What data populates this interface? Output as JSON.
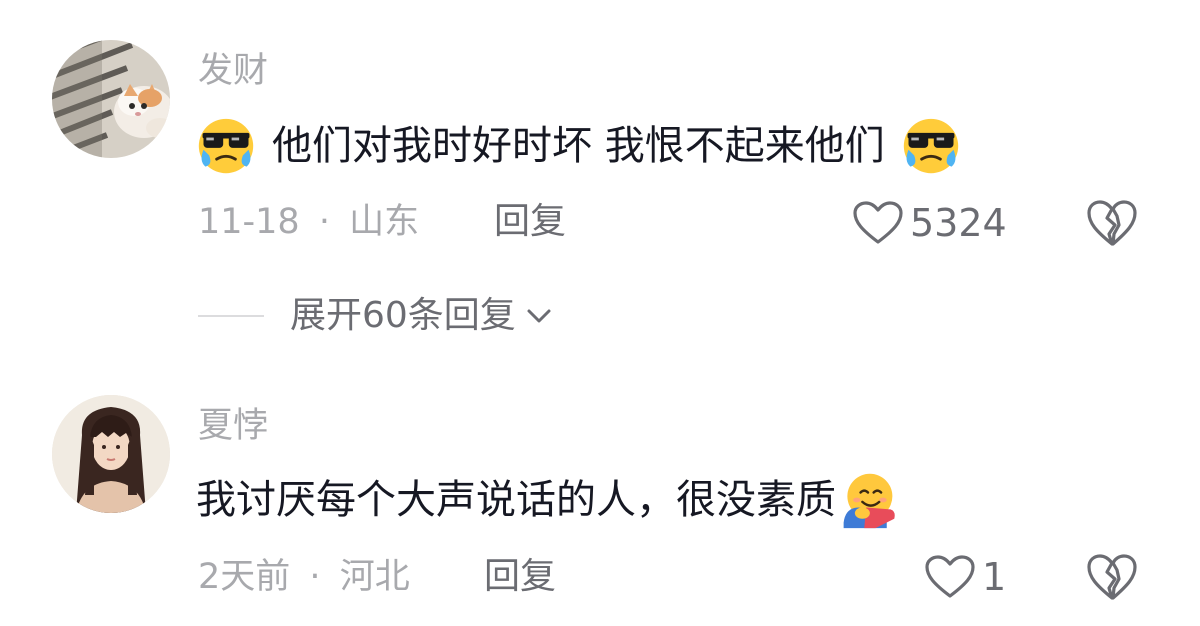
{
  "comments": [
    {
      "username": "发财",
      "text": "他们对我时好时坏 我恨不起来他们",
      "emoji_start": "sunglasses-tears-emoji",
      "emoji_end": "sunglasses-tears-emoji",
      "date": "11-18",
      "separator": "·",
      "location": "山东",
      "reply_label": "回复",
      "likes": "5324",
      "expand_label": "展开60条回复"
    },
    {
      "username": "夏悖",
      "text": "我讨厌每个大声说话的人，很没素质",
      "emoji_end": "hugging-face-emoji",
      "date": "2天前",
      "separator": "·",
      "location": "河北",
      "reply_label": "回复",
      "likes": "1"
    }
  ],
  "colors": {
    "text_primary": "#161823",
    "text_secondary": "#a8a9ad",
    "action": "#6b6c72"
  },
  "icons": [
    "heart-outline-icon",
    "broken-heart-icon",
    "chevron-down-icon"
  ]
}
